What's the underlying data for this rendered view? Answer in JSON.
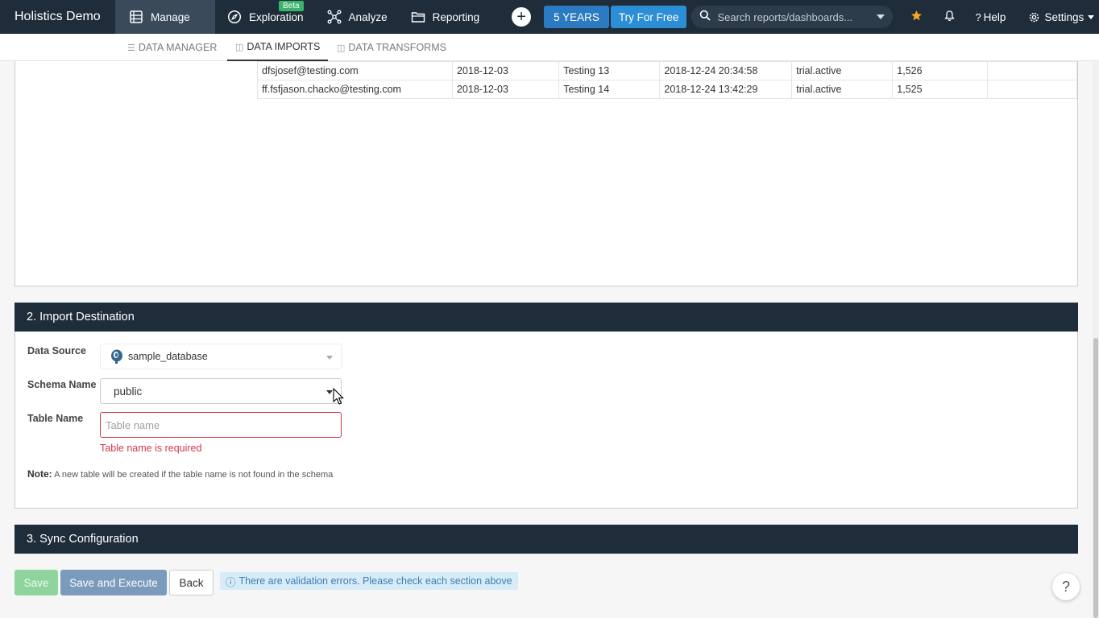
{
  "topbar": {
    "brand": "Holistics Demo",
    "nav": [
      {
        "label": "Manage",
        "icon": "table-icon",
        "active": true
      },
      {
        "label": "Exploration",
        "icon": "compass-icon",
        "badge": "Beta"
      },
      {
        "label": "Analyze",
        "icon": "nodes-icon"
      },
      {
        "label": "Reporting",
        "icon": "folder-icon"
      }
    ],
    "years_label": "5 YEARS",
    "tryfree_label": "Try For Free",
    "search_placeholder": "Search reports/dashboards...",
    "help_label": "Help",
    "settings_label": "Settings"
  },
  "subnav": {
    "tabs": [
      {
        "label": "DATA MANAGER",
        "active": false
      },
      {
        "label": "DATA IMPORTS",
        "active": true
      },
      {
        "label": "DATA TRANSFORMS",
        "active": false
      }
    ]
  },
  "preview_rows": [
    [
      "dfsjosef@testing.com",
      "2018-12-03",
      "Testing 13",
      "2018-12-24 20:34:58",
      "trial.active",
      "1,526",
      ""
    ],
    [
      "ff.fsfjason.chacko@testing.com",
      "2018-12-03",
      "Testing 14",
      "2018-12-24 13:42:29",
      "trial.active",
      "1,525",
      ""
    ]
  ],
  "import_destination": {
    "title": "2. Import Destination",
    "data_source_label": "Data Source",
    "data_source_value": "sample_database",
    "schema_label": "Schema Name",
    "schema_value": "public",
    "table_label": "Table Name",
    "table_placeholder": "Table name",
    "table_error": "Table name is required",
    "note_label": "Note:",
    "note_text": "A new table will be created if the table name is not found in the schema"
  },
  "sync_configuration": {
    "title": "3. Sync Configuration"
  },
  "footer": {
    "save_label": "Save",
    "save_execute_label": "Save and Execute",
    "back_label": "Back",
    "validation_message": "There are validation errors. Please check each section above",
    "help_fab_label": "?"
  },
  "colors": {
    "topbar_bg": "#1f2d3a",
    "accent_blue": "#2c7bc2",
    "error_red": "#d0394a",
    "save_green": "#8fd49d"
  }
}
